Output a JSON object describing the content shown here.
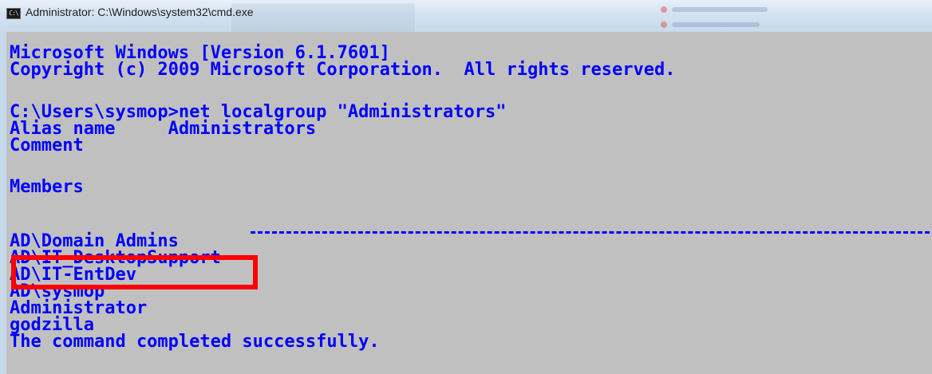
{
  "window": {
    "title": "Administrator: C:\\Windows\\system32\\cmd.exe",
    "icon": "cmd-icon",
    "icon_glyph": "C:\\"
  },
  "console": {
    "background_color": "#c0c0c0",
    "text_color": "#0000ff",
    "lines": [
      "Microsoft Windows [Version 6.1.7601]",
      "Copyright (c) 2009 Microsoft Corporation.  All rights reserved.",
      "C:\\Users\\sysmop>net localgroup \"Administrators\"",
      "Alias name     Administrators",
      "Comment",
      "Members",
      "AD\\Domain Admins",
      "AD\\IT_DesktopSupport",
      "AD\\IT-EntDev",
      "AD\\sysmop",
      "Administrator",
      "godzilla",
      "The command completed successfully."
    ]
  },
  "annotation": {
    "highlight_color": "#ff0000",
    "highlighted_entry": "AD\\Domain Admins"
  }
}
